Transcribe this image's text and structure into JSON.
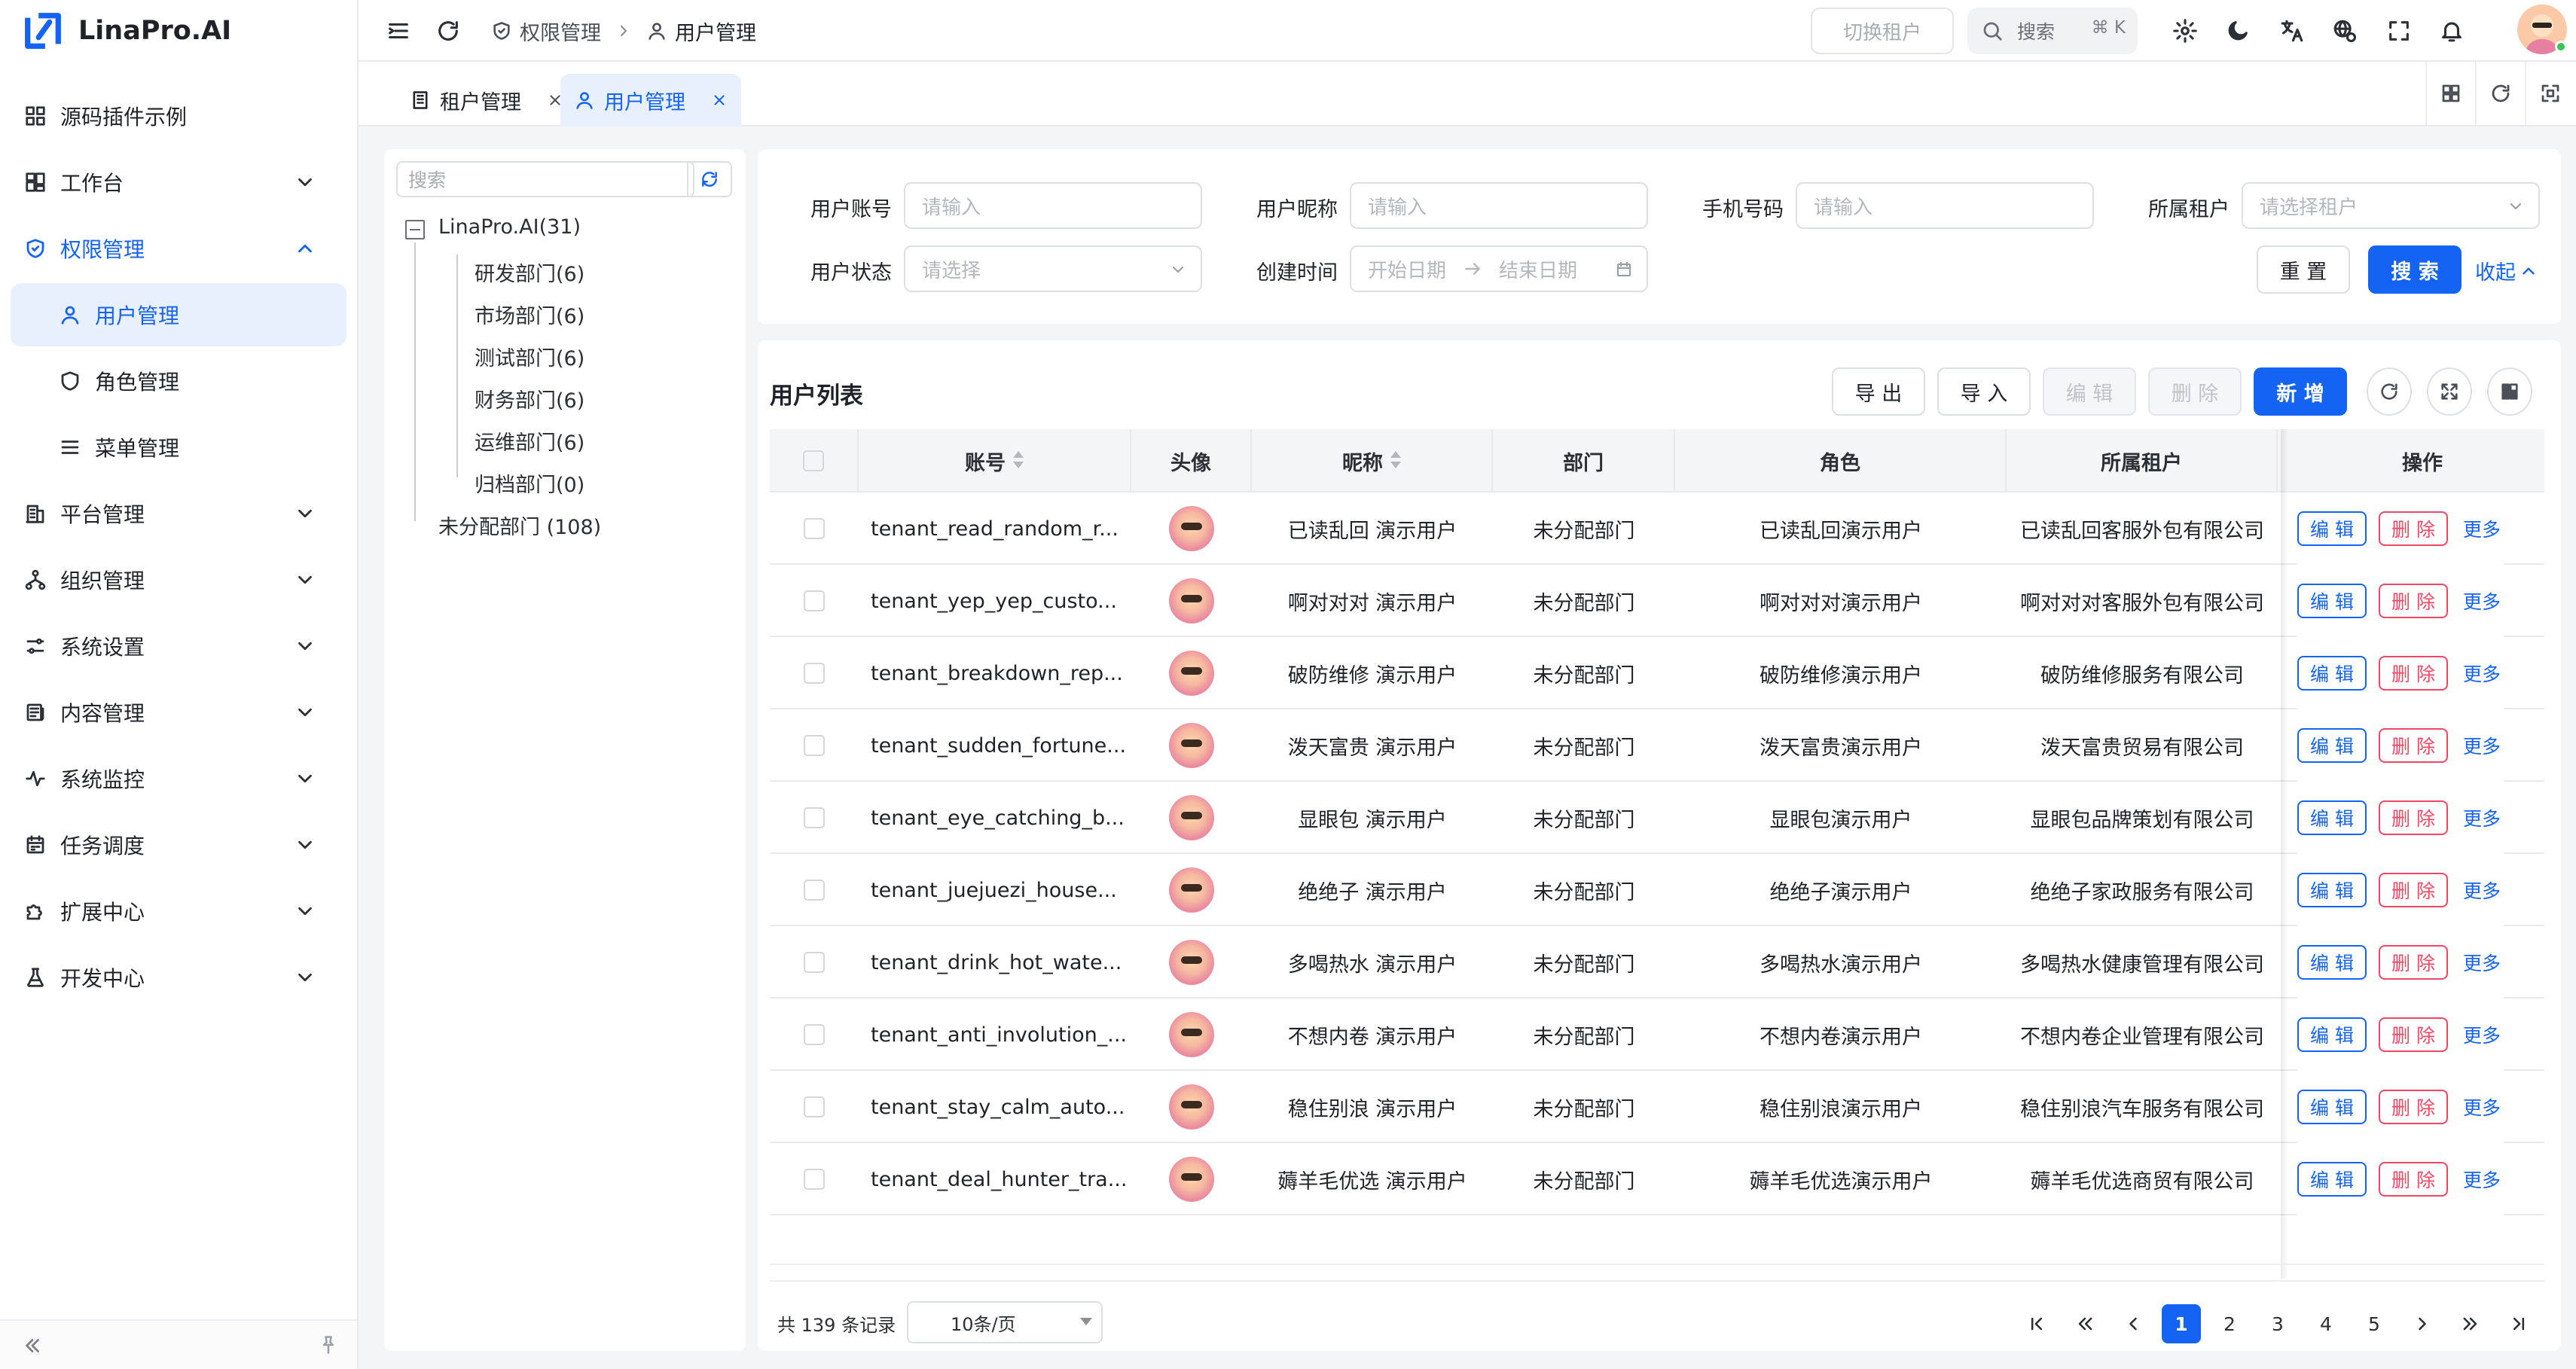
{
  "app": {
    "name": "LinaPro.AI"
  },
  "sidebar": {
    "items": [
      {
        "label": "源码插件示例",
        "icon": "grid-icon"
      },
      {
        "label": "工作台",
        "icon": "dashboard-icon"
      },
      {
        "label": "权限管理",
        "icon": "shield-icon",
        "expanded": true
      },
      {
        "label": "用户管理",
        "icon": "user-icon",
        "active": true
      },
      {
        "label": "角色管理",
        "icon": "shield-icon"
      },
      {
        "label": "菜单管理",
        "icon": "menu-icon"
      },
      {
        "label": "平台管理",
        "icon": "building-icon"
      },
      {
        "label": "组织管理",
        "icon": "org-icon"
      },
      {
        "label": "系统设置",
        "icon": "sliders-icon"
      },
      {
        "label": "内容管理",
        "icon": "newspaper-icon"
      },
      {
        "label": "系统监控",
        "icon": "pulse-icon"
      },
      {
        "label": "任务调度",
        "icon": "calendar-icon"
      },
      {
        "label": "扩展中心",
        "icon": "puzzle-icon"
      },
      {
        "label": "开发中心",
        "icon": "flask-icon"
      }
    ]
  },
  "header": {
    "breadcrumb": [
      "权限管理",
      "用户管理"
    ],
    "tenant_switch": "切换租户",
    "search_label": "搜索",
    "search_shortcut": "⌘ K"
  },
  "tabs": [
    {
      "label": "租户管理",
      "active": false
    },
    {
      "label": "用户管理",
      "active": true
    }
  ],
  "tree": {
    "search_placeholder": "搜索",
    "root": "LinaPro.AI(31)",
    "children": [
      "研发部门(6)",
      "市场部门(6)",
      "测试部门(6)",
      "财务部门(6)",
      "运维部门(6)",
      "归档部门(0)"
    ],
    "unassigned": "未分配部门 (108)"
  },
  "filter": {
    "account_label": "用户账号",
    "account_placeholder": "请输入",
    "nickname_label": "用户昵称",
    "nickname_placeholder": "请输入",
    "phone_label": "手机号码",
    "phone_placeholder": "请输入",
    "tenant_label": "所属租户",
    "tenant_placeholder": "请选择租户",
    "status_label": "用户状态",
    "status_placeholder": "请选择",
    "created_label": "创建时间",
    "start_placeholder": "开始日期",
    "end_placeholder": "结束日期",
    "reset": "重 置",
    "search": "搜 索",
    "collapse": "收起"
  },
  "list": {
    "title": "用户列表",
    "export": "导 出",
    "import": "导 入",
    "edit": "编 辑",
    "delete": "删 除",
    "add": "新 增",
    "columns": [
      "账号",
      "头像",
      "昵称",
      "部门",
      "角色",
      "所属租户",
      "操作"
    ],
    "rows": [
      {
        "account": "tenant_read_random_r...",
        "nickname": "已读乱回 演示用户",
        "dept": "未分配部门",
        "role": "已读乱回演示用户",
        "tenant": "已读乱回客服外包有限公司"
      },
      {
        "account": "tenant_yep_yep_custo...",
        "nickname": "啊对对对 演示用户",
        "dept": "未分配部门",
        "role": "啊对对对演示用户",
        "tenant": "啊对对对客服外包有限公司"
      },
      {
        "account": "tenant_breakdown_rep...",
        "nickname": "破防维修 演示用户",
        "dept": "未分配部门",
        "role": "破防维修演示用户",
        "tenant": "破防维修服务有限公司"
      },
      {
        "account": "tenant_sudden_fortune...",
        "nickname": "泼天富贵 演示用户",
        "dept": "未分配部门",
        "role": "泼天富贵演示用户",
        "tenant": "泼天富贵贸易有限公司"
      },
      {
        "account": "tenant_eye_catching_b...",
        "nickname": "显眼包 演示用户",
        "dept": "未分配部门",
        "role": "显眼包演示用户",
        "tenant": "显眼包品牌策划有限公司"
      },
      {
        "account": "tenant_juejuezi_house...",
        "nickname": "绝绝子 演示用户",
        "dept": "未分配部门",
        "role": "绝绝子演示用户",
        "tenant": "绝绝子家政服务有限公司"
      },
      {
        "account": "tenant_drink_hot_wate...",
        "nickname": "多喝热水 演示用户",
        "dept": "未分配部门",
        "role": "多喝热水演示用户",
        "tenant": "多喝热水健康管理有限公司"
      },
      {
        "account": "tenant_anti_involution_...",
        "nickname": "不想内卷 演示用户",
        "dept": "未分配部门",
        "role": "不想内卷演示用户",
        "tenant": "不想内卷企业管理有限公司"
      },
      {
        "account": "tenant_stay_calm_auto...",
        "nickname": "稳住别浪 演示用户",
        "dept": "未分配部门",
        "role": "稳住别浪演示用户",
        "tenant": "稳住别浪汽车服务有限公司"
      },
      {
        "account": "tenant_deal_hunter_tra...",
        "nickname": "薅羊毛优选 演示用户",
        "dept": "未分配部门",
        "role": "薅羊毛优选演示用户",
        "tenant": "薅羊毛优选商贸有限公司"
      }
    ],
    "row_edit": "编 辑",
    "row_delete": "删 除",
    "row_more": "更多"
  },
  "pagination": {
    "total": "共 139 条记录",
    "page_size": "10条/页",
    "pages": [
      "1",
      "2",
      "3",
      "4",
      "5"
    ],
    "current": "1"
  },
  "colors": {
    "primary": "#1463f3",
    "danger": "#f04864",
    "active_bg": "#e8f0fe"
  }
}
